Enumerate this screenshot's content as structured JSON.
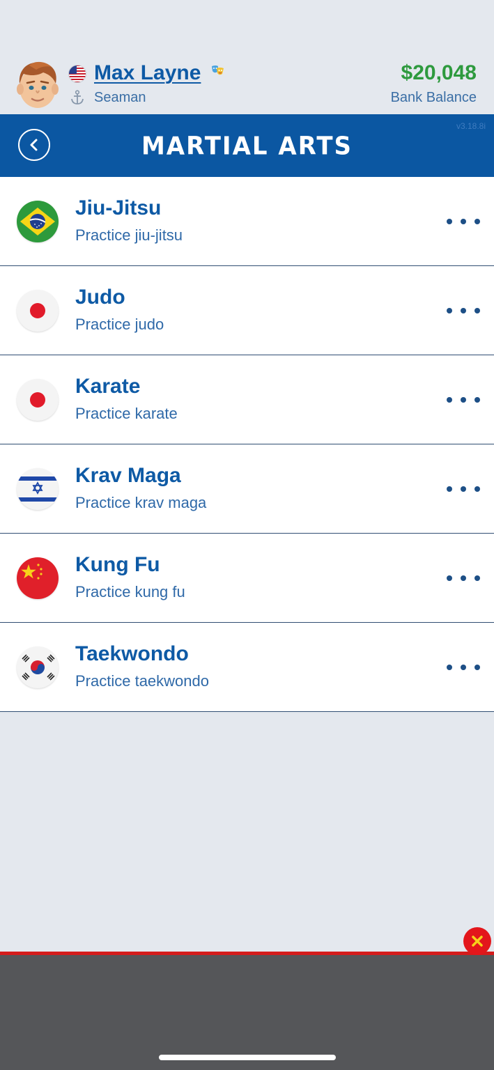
{
  "player": {
    "name": "Max Layne",
    "rank": "Seaman",
    "balance": "$20,048",
    "balance_label": "Bank Balance"
  },
  "header": {
    "title": "MARTIAL ARTS",
    "version": "v3.18.8i"
  },
  "activities": [
    {
      "title": "Jiu-Jitsu",
      "subtitle": "Practice jiu-jitsu",
      "flag": "brazil-flag-icon"
    },
    {
      "title": "Judo",
      "subtitle": "Practice judo",
      "flag": "japan-flag-icon"
    },
    {
      "title": "Karate",
      "subtitle": "Practice karate",
      "flag": "japan-flag-icon"
    },
    {
      "title": "Krav Maga",
      "subtitle": "Practice krav maga",
      "flag": "israel-flag-icon"
    },
    {
      "title": "Kung Fu",
      "subtitle": "Practice kung fu",
      "flag": "china-flag-icon"
    },
    {
      "title": "Taekwondo",
      "subtitle": "Practice taekwondo",
      "flag": "south-korea-flag-icon"
    }
  ],
  "colors": {
    "header_blue": "#0b57a2",
    "title_blue": "#0e5aa5",
    "balance_green": "#2e9a3e",
    "background": "#e4e8ee",
    "ad_close_red": "#e3161b"
  }
}
